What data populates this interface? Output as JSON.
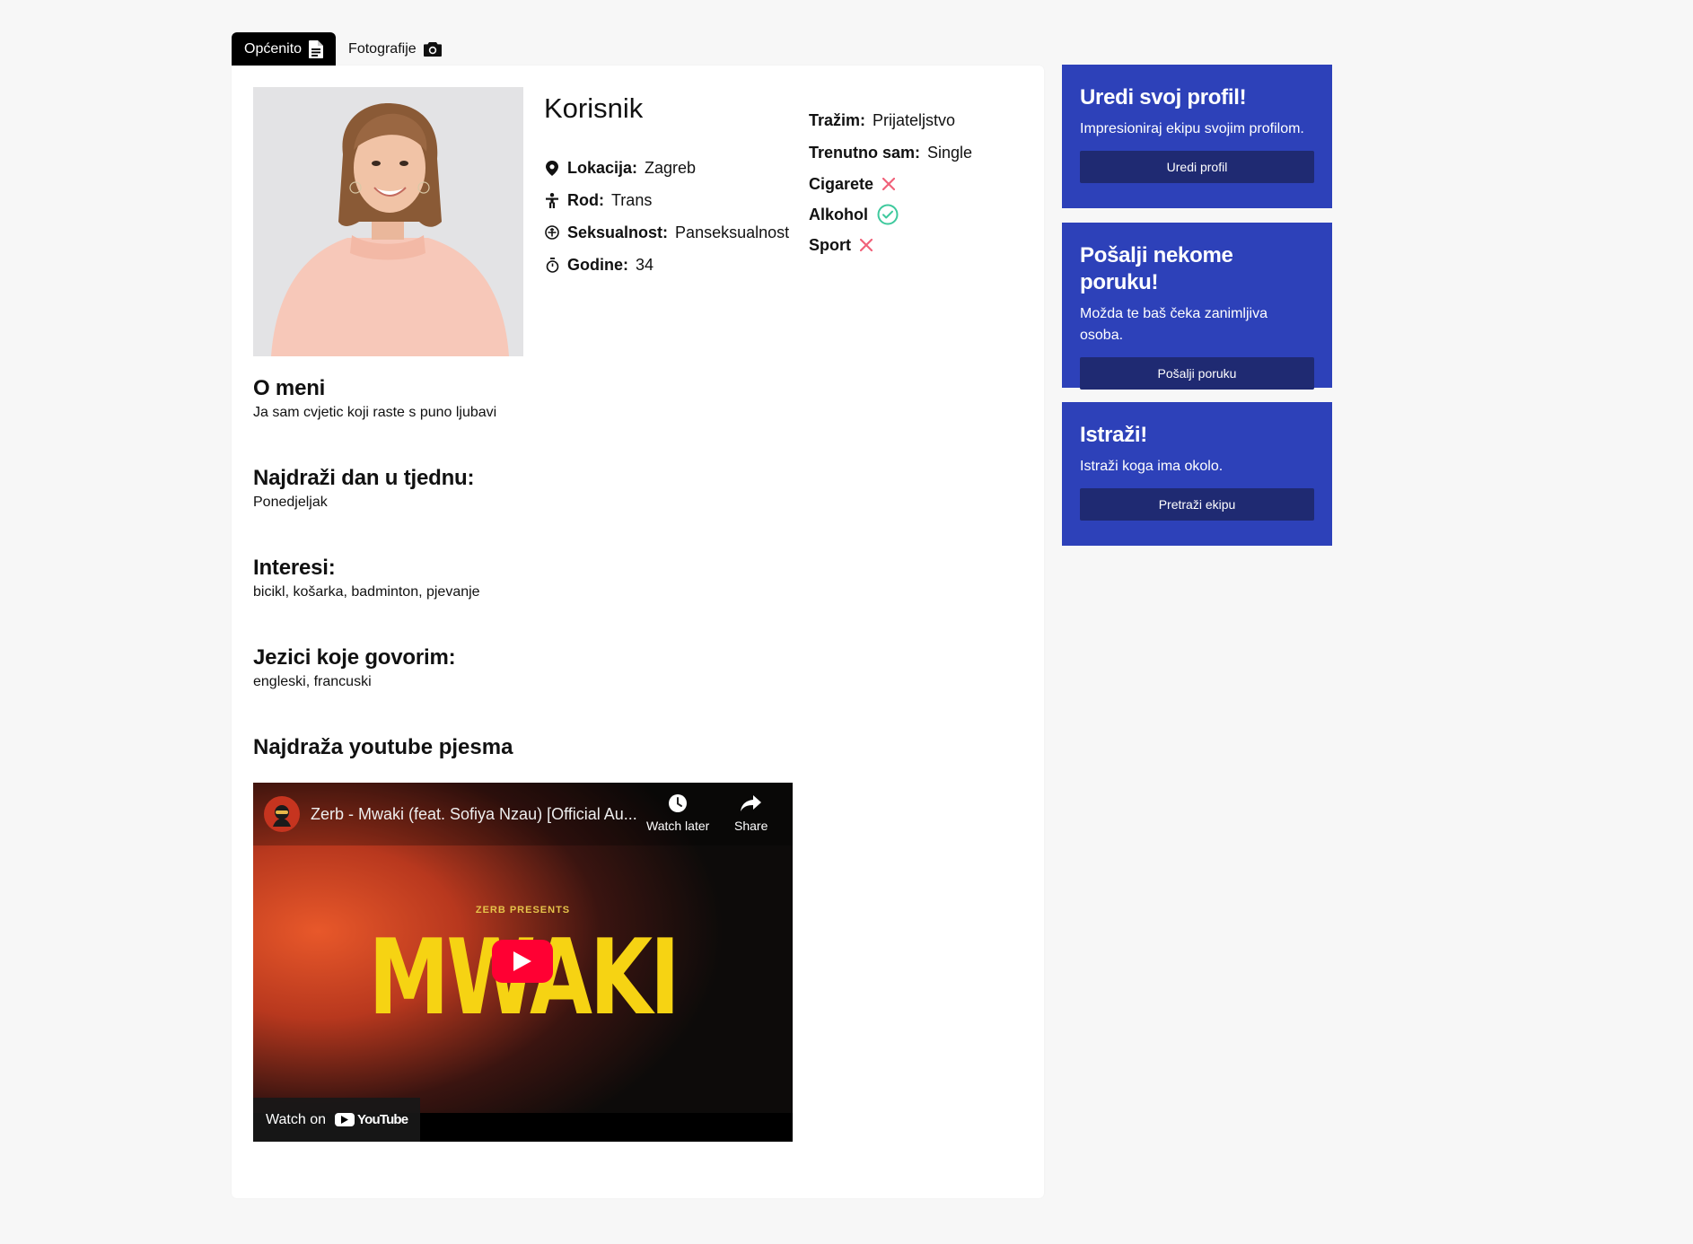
{
  "tabs": [
    {
      "label": "Općenito",
      "icon": "document-icon",
      "active": true
    },
    {
      "label": "Fotografije",
      "icon": "camera-icon",
      "active": false
    }
  ],
  "profile": {
    "username": "Korisnik",
    "info": [
      {
        "icon": "location-pin-icon",
        "label": "Lokacija:",
        "value": "Zagreb"
      },
      {
        "icon": "person-icon",
        "label": "Rod:",
        "value": "Trans"
      },
      {
        "icon": "orientation-icon",
        "label": "Seksualnost:",
        "value": "Panseksualnost"
      },
      {
        "icon": "stopwatch-icon",
        "label": "Godine:",
        "value": "34"
      }
    ],
    "looking_for": {
      "label": "Tražim:",
      "value": "Prijateljstvo"
    },
    "status": {
      "label": "Trenutno sam:",
      "value": "Single"
    },
    "habits": [
      {
        "label": "Cigarete",
        "value": false
      },
      {
        "label": "Alkohol",
        "value": true
      },
      {
        "label": "Sport",
        "value": false
      }
    ],
    "sections": [
      {
        "title": "O meni",
        "text": "Ja sam cvjetic koji raste s puno ljubavi"
      },
      {
        "title": "Najdraži dan u tjednu:",
        "text": "Ponedjeljak"
      },
      {
        "title": "Interesi:",
        "text": "bicikl, košarka, badminton, pjevanje"
      },
      {
        "title": "Jezici koje govorim:",
        "text": "engleski, francuski"
      }
    ],
    "youtube": {
      "heading": "Najdraža youtube pjesma",
      "video_title": "Zerb - Mwaki (feat. Sofiya Nzau) [Official Au...",
      "watch_later": "Watch later",
      "share": "Share",
      "thumb_small": "ZERB PRESENTS",
      "thumb_big": "MWAKI",
      "watch_on": "Watch on",
      "yt_brand": "YouTube"
    }
  },
  "sidebar": [
    {
      "title": "Uredi svoj profil!",
      "text": "Impresioniraj ekipu svojim profilom.",
      "button": "Uredi profil"
    },
    {
      "title": "Pošalji nekome poruku!",
      "text": "Možda te baš čeka zanimljiva osoba.",
      "button": "Pošalji poruku"
    },
    {
      "title": "Istraži!",
      "text": "Istraži koga ima okolo.",
      "button": "Pretraži ekipu"
    }
  ],
  "colors": {
    "accent_blue": "#2d41b9",
    "button_dark_blue": "#1f2a72",
    "check_green": "#3ec99d",
    "cross_red": "#f0627a"
  }
}
